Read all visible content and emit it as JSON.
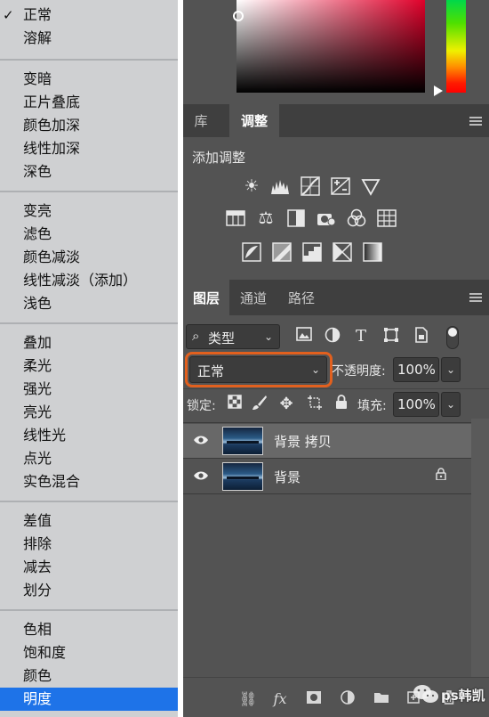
{
  "blend_menu": {
    "groups": [
      [
        "正常",
        "溶解"
      ],
      [
        "变暗",
        "正片叠底",
        "颜色加深",
        "线性加深",
        "深色"
      ],
      [
        "变亮",
        "滤色",
        "颜色减淡",
        "线性减淡（添加）",
        "浅色"
      ],
      [
        "叠加",
        "柔光",
        "强光",
        "亮光",
        "线性光",
        "点光",
        "实色混合"
      ],
      [
        "差值",
        "排除",
        "减去",
        "划分"
      ],
      [
        "色相",
        "饱和度",
        "颜色",
        "明度"
      ]
    ],
    "checked_item": "正常",
    "highlighted_item": "明度",
    "check_glyph": "✓"
  },
  "panel1": {
    "tabs": [
      "库",
      "调整"
    ],
    "active_tab": "调整",
    "title": "添加调整"
  },
  "panel2": {
    "tabs": [
      "图层",
      "通道",
      "路径"
    ],
    "active_tab": "图层",
    "filter_kind": "类型",
    "blend_mode": "正常",
    "opacity_label": "不透明度:",
    "opacity_value": "100%",
    "lock_label": "锁定:",
    "fill_label": "填充:",
    "fill_value": "100%",
    "layers": [
      {
        "name": "背景 拷贝",
        "selected": true,
        "locked": false
      },
      {
        "name": "背景",
        "selected": false,
        "locked": true
      }
    ]
  },
  "footer": {
    "fx_label": "fx"
  },
  "watermark": "ps韩凯",
  "colors": {
    "menu_bg": "#cfd0d2",
    "menu_highlight": "#1e73e8",
    "panel_bg": "#535353",
    "tab_bar": "#3f3f3f",
    "highlight_border": "#e2601e"
  },
  "icons": {
    "adjust_row1": [
      "brightness-contrast-icon",
      "levels-icon",
      "curves-icon",
      "exposure-icon",
      "vibrance-icon"
    ],
    "adjust_row2": [
      "hue-saturation-icon",
      "color-balance-icon",
      "black-white-icon",
      "photo-filter-icon",
      "channel-mixer-icon",
      "color-lookup-icon"
    ],
    "adjust_row3": [
      "invert-icon",
      "posterize-icon",
      "threshold-icon",
      "selective-color-icon",
      "gradient-map-icon"
    ],
    "filter_tools": [
      "image-filter-icon",
      "adjustment-filter-icon",
      "type-filter-icon",
      "shape-filter-icon",
      "smart-object-filter-icon"
    ],
    "lock_tools": [
      "lock-pixels-icon",
      "lock-paint-icon",
      "lock-position-icon",
      "lock-artboard-icon",
      "lock-all-icon"
    ],
    "footer": [
      "link-icon",
      "fx-icon",
      "mask-icon",
      "adjustment-layer-icon",
      "group-icon",
      "new-layer-icon",
      "trash-icon"
    ]
  }
}
